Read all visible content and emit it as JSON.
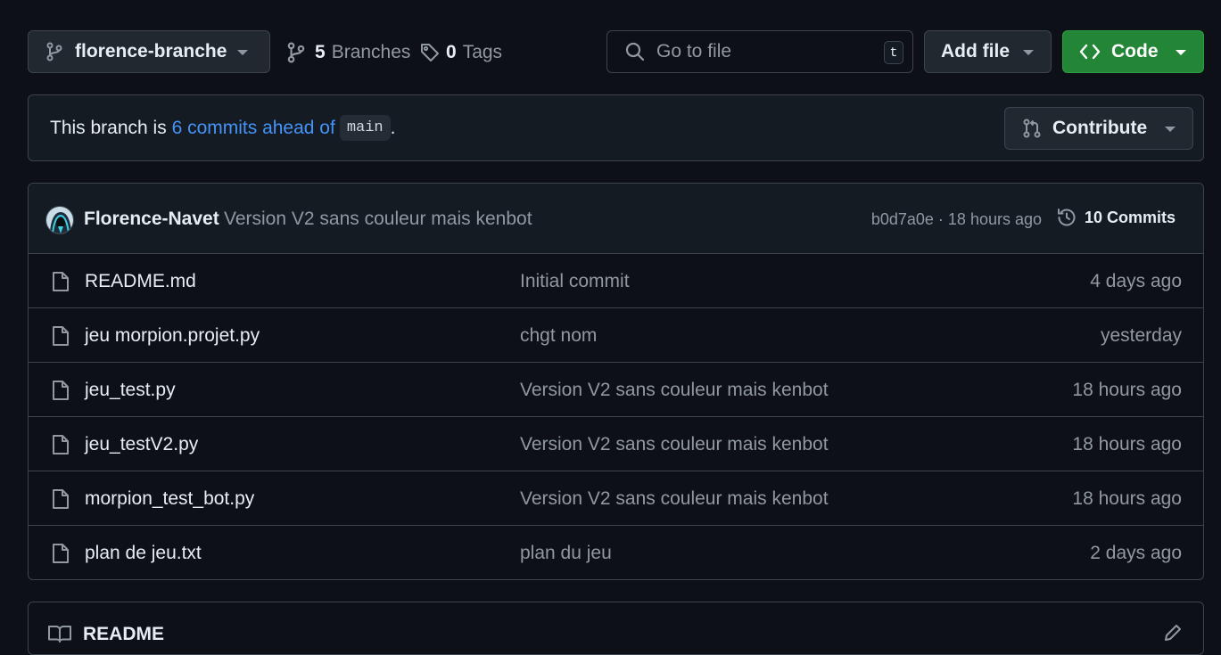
{
  "branch_select": {
    "name": "florence-branche",
    "icon": "git-branch-icon"
  },
  "branches": {
    "count": "5",
    "label": "Branches"
  },
  "tags": {
    "count": "0",
    "label": "Tags"
  },
  "search": {
    "placeholder": "Go to file",
    "shortcut": "t"
  },
  "add_file": {
    "label": "Add file"
  },
  "code": {
    "label": "Code",
    "color": "#238636"
  },
  "ahead_banner": {
    "prefix": "This branch is ",
    "link": "6 commits ahead of",
    "base": "main",
    "suffix": ".",
    "contribute_label": "Contribute"
  },
  "latest_commit": {
    "author": "Florence-Navet",
    "message": "Version V2 sans couleur mais kenbot",
    "meta": "b0d7a0e · 18 hours ago",
    "commits_label": "10 Commits"
  },
  "files": [
    {
      "name": "README.md",
      "commit": "Initial commit",
      "date": "4 days ago"
    },
    {
      "name": "jeu morpion.projet.py",
      "commit": "chgt nom",
      "date": "yesterday"
    },
    {
      "name": "jeu_test.py",
      "commit": "Version V2 sans couleur mais kenbot",
      "date": "18 hours ago"
    },
    {
      "name": "jeu_testV2.py",
      "commit": "Version V2 sans couleur mais kenbot",
      "date": "18 hours ago"
    },
    {
      "name": "morpion_test_bot.py",
      "commit": "Version V2 sans couleur mais kenbot",
      "date": "18 hours ago"
    },
    {
      "name": "plan de jeu.txt",
      "commit": "plan du jeu",
      "date": "2 days ago"
    }
  ],
  "readme": {
    "title": "README"
  },
  "colors": {
    "link": "#4493f8",
    "background": "#0d1117",
    "border": "#3d444d",
    "muted": "#9198a1"
  }
}
